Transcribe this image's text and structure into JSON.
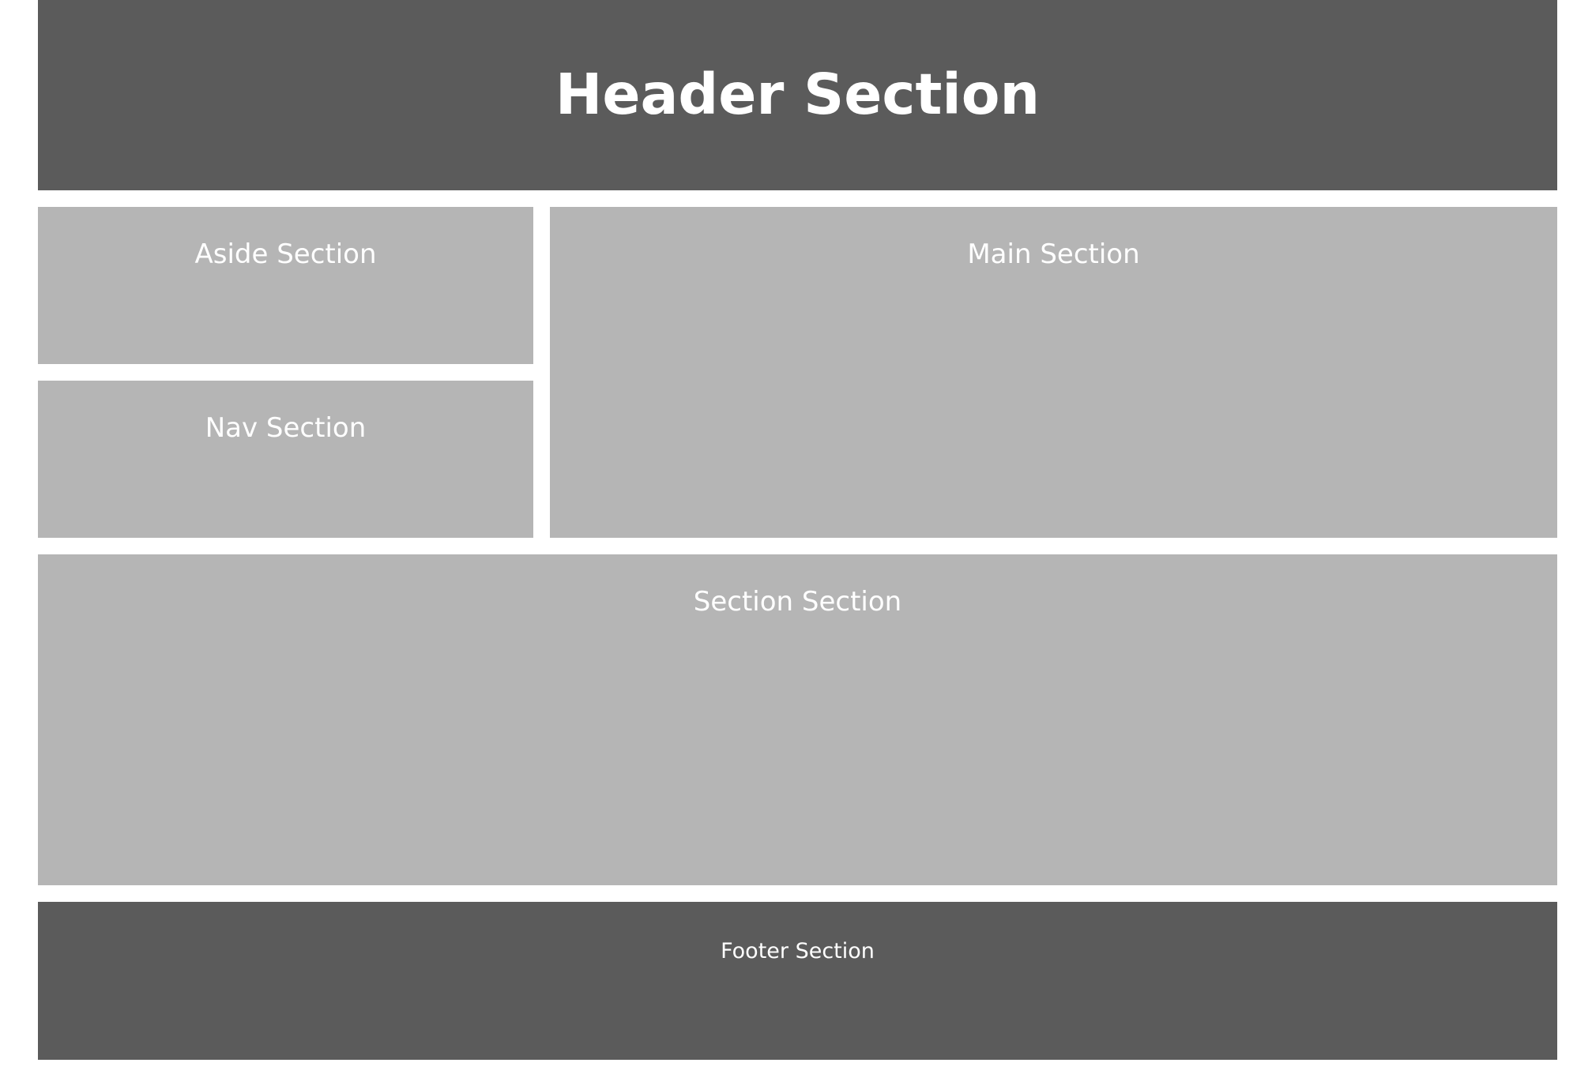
{
  "header": {
    "title": "Header Section"
  },
  "aside": {
    "title": "Aside Section"
  },
  "nav": {
    "title": "Nav Section"
  },
  "main": {
    "title": "Main Section"
  },
  "section": {
    "title": "Section Section"
  },
  "footer": {
    "title": "Footer Section"
  },
  "colors": {
    "dark_block": "#5b5b5b",
    "light_block": "#b5b5b5",
    "text": "#ffffff",
    "background": "#ffffff"
  }
}
